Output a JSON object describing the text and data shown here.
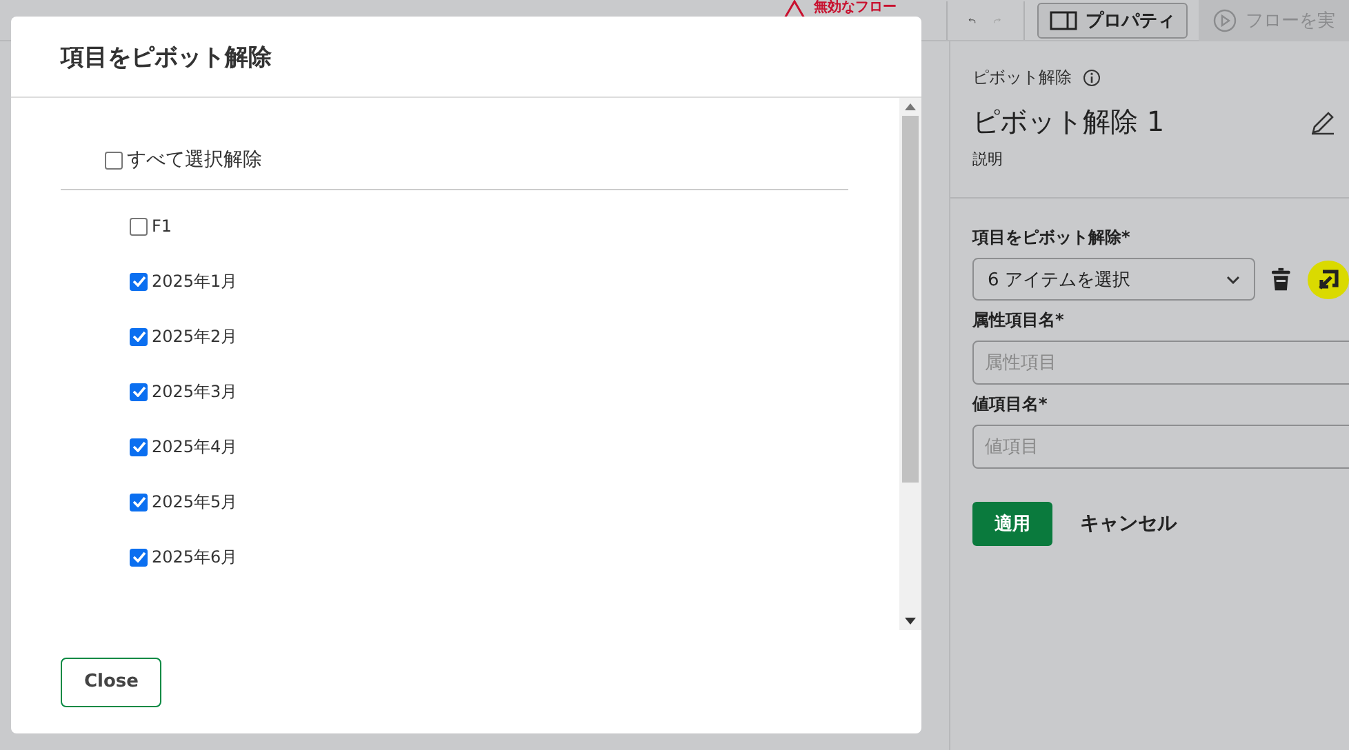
{
  "toolbar": {
    "warning": "無効なフロー",
    "properties_button": {
      "label": "プロパティ",
      "selected": true
    },
    "run_button": {
      "label": "フローを実",
      "disabled": true
    }
  },
  "panel": {
    "kind_label": "ピボット解除",
    "title": "ピボット解除 1",
    "description": "説明",
    "fields": [
      {
        "kind": "select",
        "label": "項目をピボット解除*",
        "value": "6 アイテムを選択"
      },
      {
        "kind": "text",
        "label": "属性項目名*",
        "placeholder": "属性項目"
      },
      {
        "kind": "text",
        "label": "値項目名*",
        "placeholder": "値項目"
      }
    ],
    "apply": "適用",
    "cancel": "キャンセル"
  },
  "dialog": {
    "title": "項目をピボット解除",
    "select_all": {
      "label": "すべて選択解除",
      "checked": false
    },
    "items": [
      {
        "label": "F1",
        "checked": false
      },
      {
        "label": "2025年1月",
        "checked": true
      },
      {
        "label": "2025年2月",
        "checked": true
      },
      {
        "label": "2025年3月",
        "checked": true
      },
      {
        "label": "2025年4月",
        "checked": true
      },
      {
        "label": "2025年5月",
        "checked": true
      },
      {
        "label": "2025年6月",
        "checked": true
      }
    ],
    "close": "Close"
  }
}
